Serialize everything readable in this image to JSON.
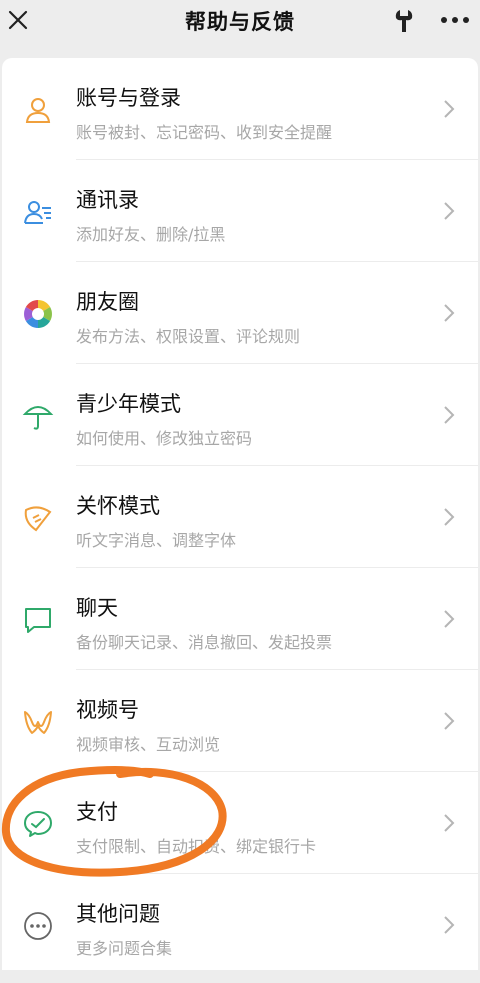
{
  "header": {
    "title": "帮助与反馈",
    "close_icon": "close-icon",
    "tool_icon": "wrench-icon",
    "more_icon": "more-icon"
  },
  "items": [
    {
      "label": "账号与登录",
      "sub": "账号被封、忘记密码、收到安全提醒",
      "icon": "person-icon",
      "color": "#f0a03c"
    },
    {
      "label": "通讯录",
      "sub": "添加好友、删除/拉黑",
      "icon": "contacts-icon",
      "color": "#3b8ee0"
    },
    {
      "label": "朋友圈",
      "sub": "发布方法、权限设置、评论规则",
      "icon": "moments-icon",
      "color": "#e24a4a"
    },
    {
      "label": "青少年模式",
      "sub": "如何使用、修改独立密码",
      "icon": "umbrella-icon",
      "color": "#2fa96a"
    },
    {
      "label": "关怀模式",
      "sub": "听文字消息、调整字体",
      "icon": "care-icon",
      "color": "#f0a03c"
    },
    {
      "label": "聊天",
      "sub": "备份聊天记录、消息撤回、发起投票",
      "icon": "chat-icon",
      "color": "#2fa96a"
    },
    {
      "label": "视频号",
      "sub": "视频审核、互动浏览",
      "icon": "channels-icon",
      "color": "#f0a03c"
    },
    {
      "label": "支付",
      "sub": "支付限制、自动扣费、绑定银行卡",
      "icon": "pay-icon",
      "color": "#2fa96a"
    },
    {
      "label": "其他问题",
      "sub": "更多问题合集",
      "icon": "ellipsis-circle-icon",
      "color": "#666666"
    }
  ],
  "annotation_color": "#f07a24"
}
